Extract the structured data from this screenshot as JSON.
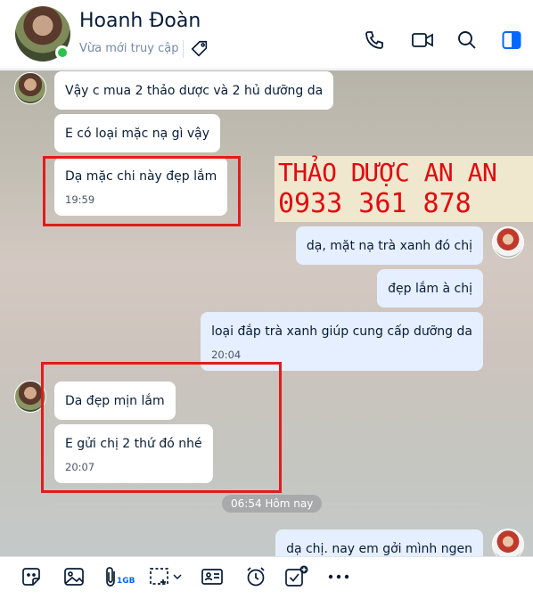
{
  "header": {
    "name": "Hoanh Đoàn",
    "status": "Vừa mới truy cập"
  },
  "watermark": {
    "line1": "THẢO DƯỢC AN AN",
    "line2": "0933 361 878"
  },
  "messages": {
    "m1": {
      "text": "Vậy c mua 2 thảo dược và 2 hủ dưỡng da"
    },
    "m2": {
      "text": "E có loại mặc nạ gì vậy"
    },
    "m3": {
      "text": "Dạ mặc chi này đẹp lắm",
      "time": "19:59"
    },
    "m4": {
      "text": "dạ, mặt nạ trà xanh đó chị"
    },
    "m5": {
      "text": "đẹp lắm à chị"
    },
    "m6": {
      "text": "loại đắp trà xanh giúp cung cấp dưỡng da",
      "time": "20:04"
    },
    "m7": {
      "text": "Da đẹp mịn lắm"
    },
    "m8": {
      "text": "E gửi chị  2 thứ đó nhé",
      "time": "20:07"
    },
    "m9": {
      "text": "dạ chị.  nay em gởi mình ngen"
    }
  },
  "divider": {
    "label": "06:54 Hôm nay"
  },
  "toolbar": {
    "file_badge": "1GB"
  },
  "colors": {
    "accent": "#0068ff",
    "highlight_box": "#e01c1c",
    "watermark_text": "#e00b10"
  }
}
